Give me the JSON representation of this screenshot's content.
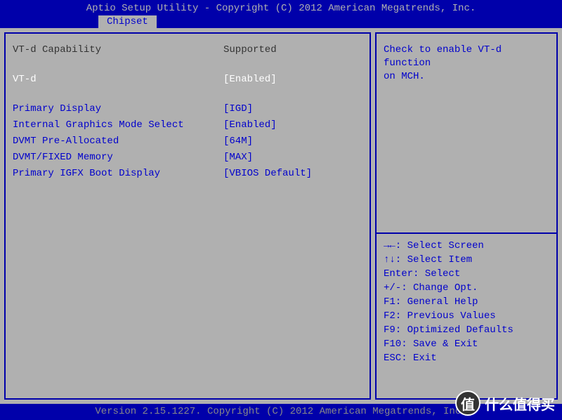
{
  "header": {
    "title": "Aptio Setup Utility - Copyright (C) 2012 American Megatrends, Inc.",
    "active_tab": "Chipset"
  },
  "settings": {
    "info_row": {
      "label": "VT-d Capability",
      "value": "Supported"
    },
    "selected_row": {
      "label": "VT-d",
      "value": "[Enabled]"
    },
    "options": [
      {
        "label": "Primary Display",
        "value": "[IGD]"
      },
      {
        "label": "Internal Graphics Mode Select",
        "value": "[Enabled]"
      },
      {
        "label": "DVMT Pre-Allocated",
        "value": "[64M]"
      },
      {
        "label": "DVMT/FIXED Memory",
        "value": "[MAX]"
      },
      {
        "label": "Primary IGFX Boot Display",
        "value": "[VBIOS Default]"
      }
    ]
  },
  "help": {
    "text_line1": "Check to enable VT-d function",
    "text_line2": "on MCH."
  },
  "keys": {
    "k0": "→←: Select Screen",
    "k1": "↑↓: Select Item",
    "k2": "Enter: Select",
    "k3": "+/-: Change Opt.",
    "k4": "F1: General Help",
    "k5": "F2: Previous Values",
    "k6": "F9: Optimized Defaults",
    "k7": "F10: Save & Exit",
    "k8": "ESC: Exit"
  },
  "footer": {
    "text": "Version 2.15.1227. Copyright (C) 2012 American Megatrends, Inc."
  },
  "watermark": {
    "icon": "值",
    "text": "什么值得买"
  }
}
